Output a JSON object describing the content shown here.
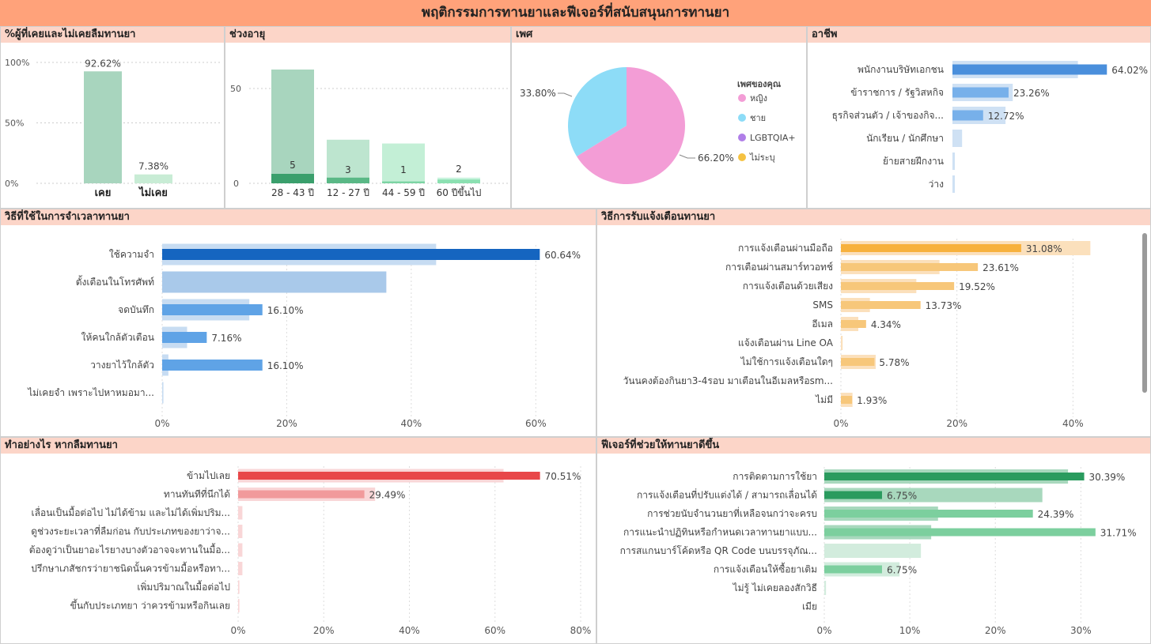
{
  "page": {
    "title": "พฤติกรรมการทานยาและฟีเจอร์ที่สนับสนุนการทานยา"
  },
  "colors": {
    "header_bg": "#ffa27a",
    "panel_header_bg": "#fcd5c8",
    "green_light": "#a8d5be",
    "green_dark": "#3a9f6c",
    "blue_dark": "#1565c0",
    "blue_mid": "#5fa3e6",
    "blue_light": "#a9c9ea",
    "orange": "#f7b13d",
    "orange_light": "#fbd9a6",
    "red": "#e84749",
    "red_light": "#f6b2b3",
    "pie_female": "#f39dd6",
    "pie_male": "#8ddcf7",
    "pie_lgbt": "#b07ee8",
    "pie_na": "#f5c242"
  },
  "chart_data": [
    {
      "id": "forgot",
      "type": "bar",
      "title": "%ผู้ที่เคยและไม่เคยลืมทานยา",
      "categories": [
        "เคย",
        "ไม่เคย"
      ],
      "values": [
        92.62,
        7.38
      ],
      "value_labels": [
        "92.62%",
        "7.38%"
      ],
      "yticks": [
        "100%",
        "50%",
        "0%"
      ],
      "ylim": [
        0,
        100
      ]
    },
    {
      "id": "age",
      "type": "bar",
      "title": "ช่วงอายุ",
      "categories": [
        "28 - 43 ปี",
        "12 - 27 ปี",
        "44 - 59 ปี",
        "60 ปีขึ้นไป"
      ],
      "series": [
        {
          "values": [
            60,
            23,
            21,
            3
          ]
        },
        {
          "values": [
            5,
            3,
            1,
            2
          ]
        }
      ],
      "value_labels": [
        "5",
        "3",
        "1",
        "2"
      ],
      "yticks": [
        "50",
        "0"
      ],
      "ylim": [
        0,
        70
      ]
    },
    {
      "id": "gender",
      "type": "pie",
      "title": "เพศ",
      "legend_title": "เพศของคุณ",
      "legend_position": "right",
      "labels": [
        "หญิง",
        "ชาย",
        "LGBTQIA+",
        "ไม่ระบุ"
      ],
      "values": [
        66.2,
        33.8,
        0,
        0
      ],
      "value_labels": [
        "66.20%",
        "33.80%"
      ]
    },
    {
      "id": "occupation",
      "type": "bar",
      "orientation": "horizontal",
      "title": "อาชีพ",
      "categories": [
        "พนักงานบริษัทเอกชน",
        "ข้าราชการ / รัฐวิสหกิจ",
        "ธุรกิจส่วนตัว / เจ้าของกิจ...",
        "นักเรียน / นักศึกษา",
        "ย้ายสายฝึกงาน",
        "ว่าง"
      ],
      "series": [
        {
          "values": [
            52,
            25,
            22,
            4,
            1,
            1
          ]
        },
        {
          "values": [
            64.02,
            23.26,
            12.72,
            0,
            0,
            0
          ]
        }
      ],
      "value_labels": [
        "64.02%",
        "23.26%",
        "12.72%",
        "",
        "",
        ""
      ],
      "xlim": [
        0,
        80
      ]
    },
    {
      "id": "remember",
      "type": "bar",
      "orientation": "horizontal",
      "title": "วิธีที่ใช้ในการจำเวลาทานยา",
      "categories": [
        "ใช้ความจำ",
        "ตั้งเตือนในโทรศัพท์",
        "จดบันทึก",
        "ให้คนใกล้ตัวเตือน",
        "วางยาไว้ใกล้ตัว",
        "ไม่เคยจำ เพราะไปหาหมอมา..."
      ],
      "series": [
        {
          "values": [
            44,
            36,
            14,
            4,
            1,
            0.2
          ]
        },
        {
          "values": [
            60.64,
            0,
            16.1,
            7.16,
            16.1,
            0
          ]
        }
      ],
      "value_labels": [
        "60.64%",
        "",
        "16.10%",
        "7.16%",
        "16.10%",
        ""
      ],
      "xticks": [
        "0%",
        "20%",
        "40%",
        "60%"
      ],
      "xlim": [
        0,
        70
      ]
    },
    {
      "id": "notify",
      "type": "bar",
      "orientation": "horizontal",
      "title": "วิธีการรับแจ้งเตือนทานยา",
      "categories": [
        "การแจ้งเตือนผ่านมือถือ",
        "การเตือนผ่านสมาร์ทวอทช์",
        "การแจ้งเตือนด้วยเสียง",
        "SMS",
        "อีเมล",
        "แจ้งเตือนผ่าน Line OA",
        "ไม่ใช้การแจ้งเตือนใดๆ",
        "วันนคงต้องกินยา3-4รอบ มาเตือนในอีเมลหรือsm...",
        "ไม่มี"
      ],
      "series": [
        {
          "values": [
            43,
            17,
            13,
            5,
            3,
            0.3,
            6,
            0,
            2
          ]
        },
        {
          "values": [
            31.08,
            23.61,
            19.52,
            13.73,
            4.34,
            0,
            5.78,
            0,
            1.93
          ]
        }
      ],
      "value_labels": [
        "31.08%",
        "23.61%",
        "19.52%",
        "13.73%",
        "4.34%",
        "",
        "5.78%",
        "",
        "1.93%"
      ],
      "xticks": [
        "0%",
        "20%",
        "40%"
      ],
      "xlim": [
        0,
        45
      ]
    },
    {
      "id": "forgot_action",
      "type": "bar",
      "orientation": "horizontal",
      "title": "ทำอย่างไร หากลืมทานยา",
      "categories": [
        "ข้ามไปเลย",
        "ทานทันทีที่นึกได้",
        "เลื่อนเป็นมื้อต่อไป ไม่ได้ข้าม และไม่ได้เพิ่มปริม...",
        "ดูช่วงระยะเวลาที่ลืมก่อน กับประเภทของยาว่าจ...",
        "ต้องดูว่าเป็นยาอะไรยางบางตัวอาจจะทานในมื้อ...",
        "ปรึกษาเภสัชกรว่ายาชนิดนั้นควรข้ามมื้อหรือทา...",
        "เพิ่มปริมาณในมื้อต่อไป",
        "ขึ้นกับประเภทยา ว่าควรข้ามหรือกินเลย"
      ],
      "series": [
        {
          "values": [
            62,
            32,
            1,
            1,
            1,
            1,
            0.3,
            0.3
          ]
        },
        {
          "values": [
            70.51,
            29.49,
            0,
            0,
            0,
            0,
            0,
            0
          ]
        }
      ],
      "value_labels": [
        "70.51%",
        "29.49%",
        "",
        "",
        "",
        "",
        "",
        ""
      ],
      "xticks": [
        "0%",
        "20%",
        "40%",
        "60%",
        "80%"
      ],
      "xlim": [
        0,
        80
      ]
    },
    {
      "id": "features",
      "type": "bar",
      "orientation": "horizontal",
      "title": "ฟีเจอร์ที่ช่วยให้ทานยาดีขึ้น",
      "categories": [
        "การติดตามการใช้ยา",
        "การแจ้งเตือนที่ปรับแต่งได้ / สามารถเลื่อนได้",
        "การช่วยนับจำนวนยาที่เหลือจนกว่าจะครบ",
        "การแนะนำปฏิทินหรือกำหนดเวลาทานยาแบบ...",
        "การสแกนบาร์โค้ดหรือ QR Code บนบรรจุภัณ...",
        "การแจ้งเตือนให้ซื้อยาเติม",
        "ไม่รู้ ไม่เคยลองสักวิธี",
        "เมีย"
      ],
      "series": [
        {
          "values": [
            28.5,
            25.5,
            13.3,
            12.5,
            11.3,
            8.8,
            0.2,
            0
          ]
        },
        {
          "values": [
            30.39,
            6.75,
            24.39,
            31.71,
            0,
            6.75,
            0,
            0
          ]
        }
      ],
      "value_labels": [
        "30.39%",
        "6.75%",
        "24.39%",
        "31.71%",
        "",
        "6.75%",
        "",
        ""
      ],
      "xticks": [
        "0%",
        "10%",
        "20%",
        "30%"
      ],
      "xlim": [
        0,
        37
      ]
    }
  ]
}
